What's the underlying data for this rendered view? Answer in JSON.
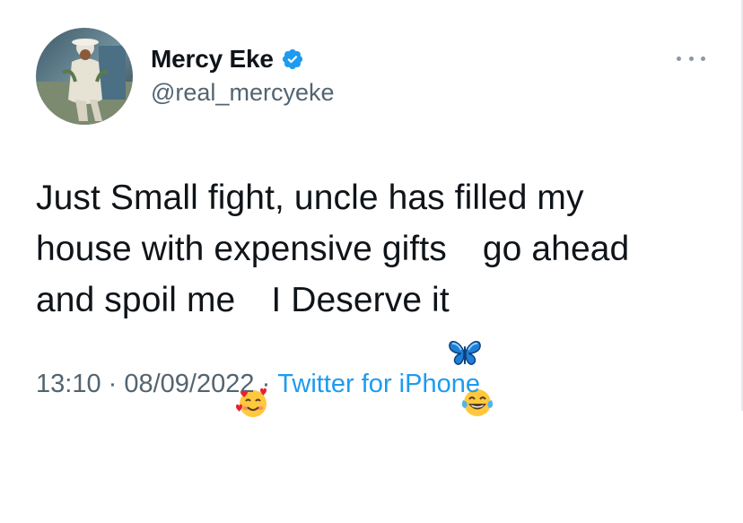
{
  "author": {
    "display_name": "Mercy Eke",
    "handle": "@real_mercyeke",
    "verified": true
  },
  "tweet": {
    "line1": "Just Small fight, uncle has filled my",
    "line2a": "house with expensive gifts",
    "line2b": "go ahead",
    "line3a": "and spoil me",
    "line3b": "I Deserve it ",
    "emojis": [
      "butterfly-emoji",
      "smiling-face-with-hearts-emoji",
      "face-with-tears-of-joy-emoji"
    ]
  },
  "meta": {
    "time": "13:10",
    "separator": " · ",
    "date": "08/09/2022",
    "source": "Twitter for iPhone"
  },
  "colors": {
    "text": "#0f1419",
    "secondary": "#536471",
    "link": "#1d9bf0",
    "verified": "#1d9bf0"
  }
}
